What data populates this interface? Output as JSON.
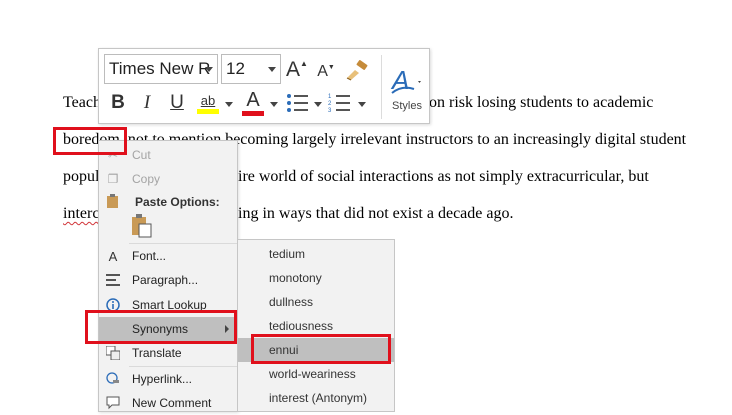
{
  "document": {
    "lines": [
      {
        "before": "Teach",
        "after": "on risk losing students to academic"
      },
      {
        "word": "boredom",
        "rest": ", not to mention becoming largely irrelevant instructors to an increasingly digital student"
      },
      {
        "start": "popul",
        "rest": "ire world of social interactions as not simply extracurricular, but"
      },
      {
        "start": "interc",
        "rest": "ing in ways that did not exist a decade ago."
      }
    ]
  },
  "mini_toolbar": {
    "font_name": "Times New R",
    "font_size": "12",
    "grow_font": "A",
    "shrink_font": "A",
    "bold": "B",
    "italic": "I",
    "underline": "U",
    "highlight": "ab",
    "font_color": "A",
    "styles_label": "Styles",
    "highlight_color": "#ffff00",
    "font_color_bar": "#e0101c",
    "icons": [
      "format-painter-icon",
      "bullets-icon",
      "numbering-icon",
      "styles-icon"
    ]
  },
  "context_menu": {
    "cut": "Cut",
    "copy": "Copy",
    "paste_options": "Paste Options:",
    "font": "Font...",
    "paragraph": "Paragraph...",
    "smart_lookup": "Smart Lookup",
    "synonyms": "Synonyms",
    "translate": "Translate",
    "hyperlink": "Hyperlink...",
    "new_comment": "New Comment"
  },
  "synonyms_submenu": {
    "items": [
      "tedium",
      "monotony",
      "dullness",
      "tediousness",
      "ennui",
      "world-weariness",
      "interest (Antonym)"
    ],
    "selected": "ennui"
  },
  "annotation_color": "#e0101c"
}
